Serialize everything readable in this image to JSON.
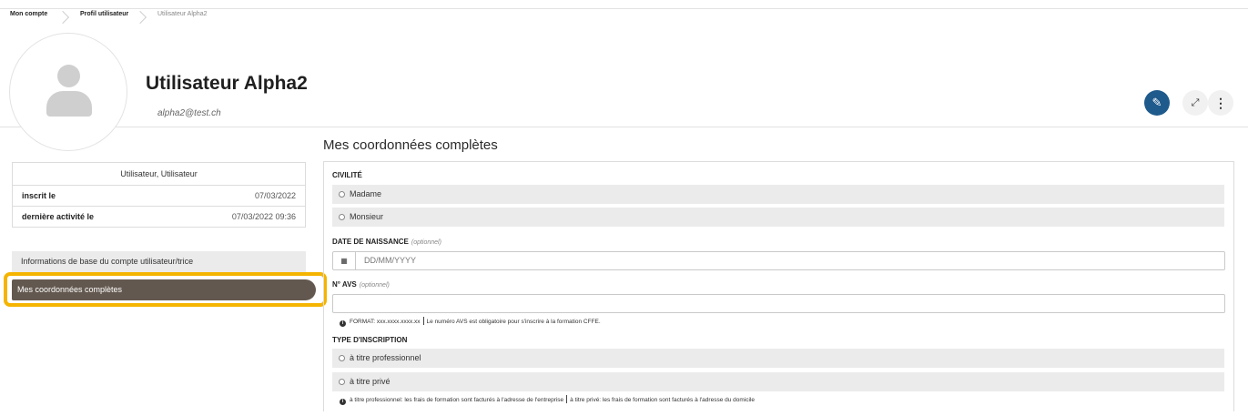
{
  "breadcrumb": {
    "items": [
      "Mon compte",
      "Profil utilisateur",
      "Utilisateur Alpha2"
    ]
  },
  "profile": {
    "name": "Utilisateur Alpha2",
    "email": "alpha2@test.ch"
  },
  "actions": {
    "edit_icon": "pencil-icon",
    "expand_icon": "expand-icon",
    "more_icon": "more-vertical-icon"
  },
  "info_card": {
    "title": "Utilisateur, Utilisateur",
    "rows": [
      {
        "label": "inscrit le",
        "value": "07/03/2022"
      },
      {
        "label": "dernière activité le",
        "value": "07/03/2022 09:36"
      }
    ]
  },
  "nav": {
    "items": [
      {
        "label": "Informations de base du compte utilisateur/trice",
        "active": false
      },
      {
        "label": "Mes coordonnées complètes",
        "active": true
      }
    ],
    "highlight_color": "#f5b400",
    "active_color": "#63584f"
  },
  "form": {
    "title": "Mes coordonnées complètes",
    "civilite": {
      "label": "CIVILITÉ",
      "options": [
        "Madame",
        "Monsieur"
      ]
    },
    "date_naissance": {
      "label": "DATE DE NAISSANCE",
      "optional": "(optionnel)",
      "placeholder": "DD/MM/YYYY"
    },
    "avs": {
      "label": "N° AVS",
      "optional": "(optionnel)",
      "value": "",
      "hint_a": "FORMAT: xxx.xxxx.xxxx.xx",
      "hint_b": "Le numéro AVS est obligatoire pour s'inscrire à la formation CFFE."
    },
    "type_inscription": {
      "label": "TYPE D'INSCRIPTION",
      "options": [
        "à titre professionnel",
        "à titre privé"
      ],
      "hint_a": "à titre professionnel: les frais de formation sont facturés à l'adresse de l'entreprise",
      "hint_b": "à titre privé: les frais de formation sont facturés à l'adresse du domicile"
    }
  },
  "colors": {
    "primary": "#1f5a8c",
    "highlight": "#f5b400"
  }
}
